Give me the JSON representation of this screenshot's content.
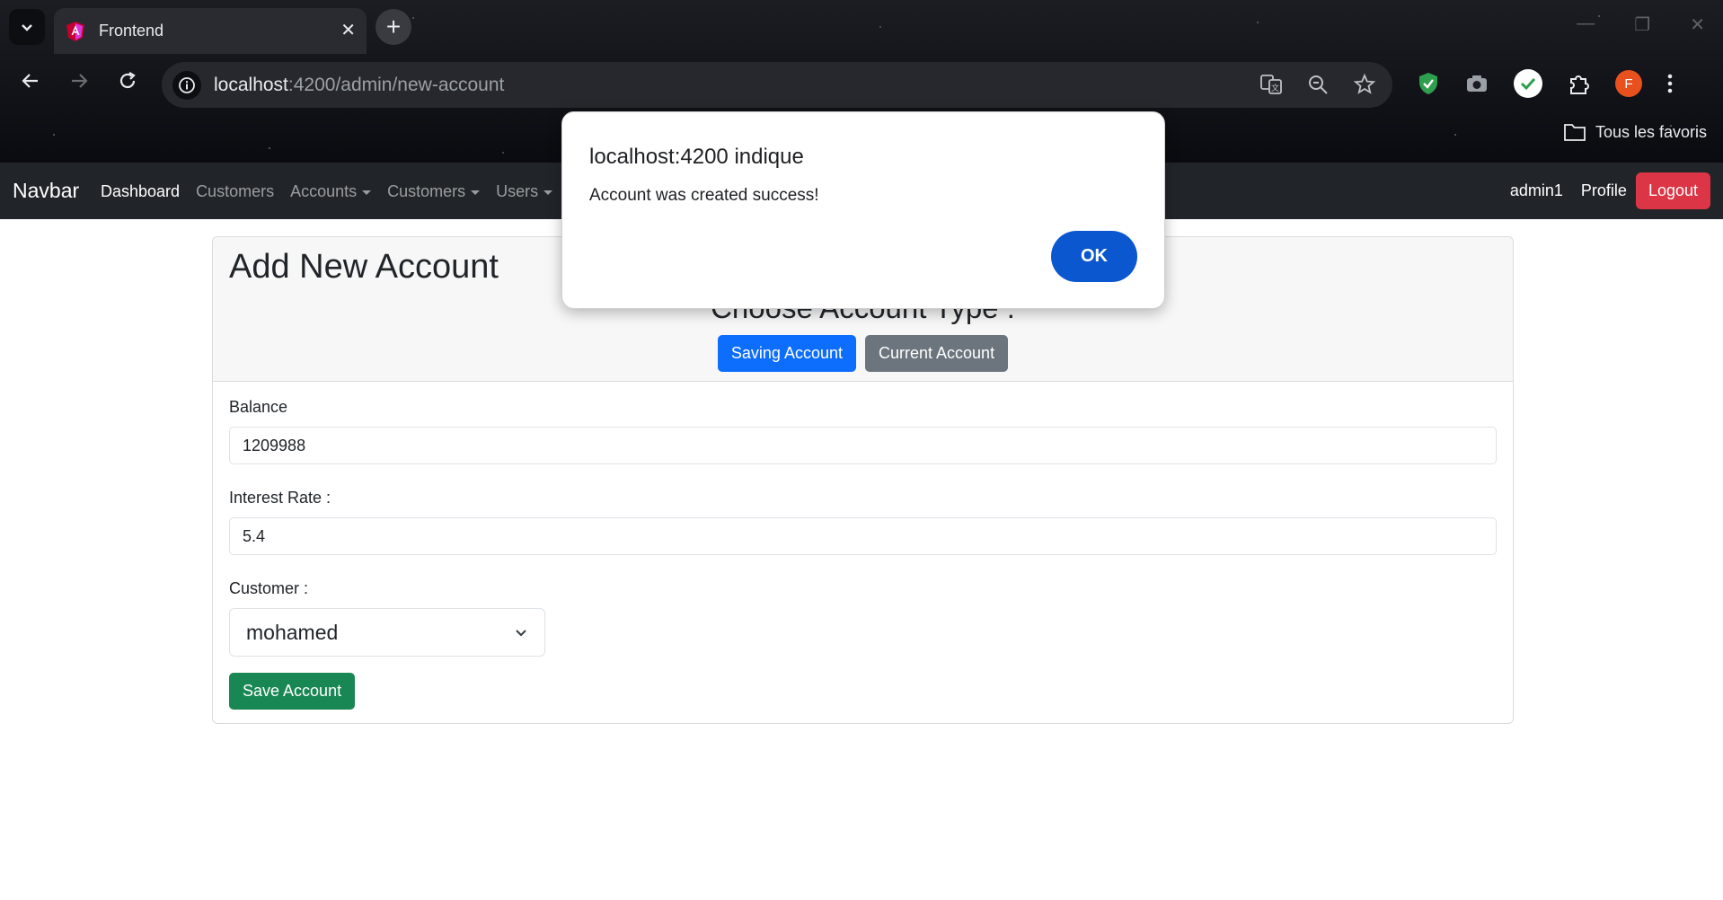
{
  "browser": {
    "tab_title": "Frontend",
    "tab_close": "✕",
    "new_tab": "+",
    "url_host": "localhost",
    "url_rest": ":4200/admin/new-account",
    "profile_initial": "F",
    "bookmarks_label": "Tous les favoris"
  },
  "navbar": {
    "brand": "Navbar",
    "links": [
      {
        "label": "Dashboard"
      },
      {
        "label": "Customers"
      },
      {
        "label": "Accounts"
      },
      {
        "label": "Customers"
      },
      {
        "label": "Users"
      }
    ],
    "username": "admin1",
    "profile": "Profile",
    "logout": "Logout"
  },
  "card": {
    "title": "Add New Account",
    "choose_title": "Choose Account Type :",
    "saving_btn": "Saving Account",
    "current_btn": "Current Account",
    "balance_label": "Balance",
    "balance_value": "1209988",
    "interest_label": "Interest Rate :",
    "interest_value": "5.4",
    "customer_label": "Customer :",
    "customer_value": "mohamed",
    "save_btn": "Save Account"
  },
  "dialog": {
    "title": "localhost:4200 indique",
    "message": "Account was created success!",
    "ok": "OK"
  },
  "colors": {
    "primary": "#0d6efd",
    "secondary": "#6c757d",
    "success": "#198754",
    "danger": "#dc3545",
    "navbar_bg": "#212529",
    "dialog_ok": "#0b57d0"
  }
}
